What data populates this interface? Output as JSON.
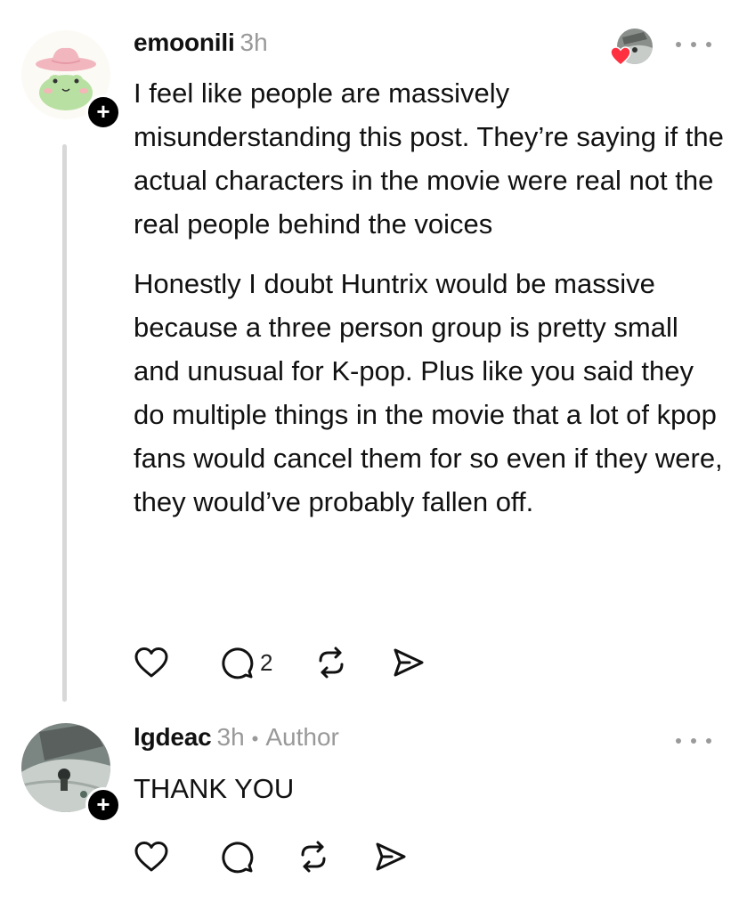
{
  "posts": [
    {
      "username": "emoonili",
      "time": "3h",
      "paragraphs": [
        "I feel like people are massively misunderstanding this post. They’re saying if the actual characters in the movie were real not the real people behind the voices",
        "Honestly I doubt Huntrix would be massive because a three person group is pretty small and unusual for K-pop. Plus like you said they do multiple things in the movie that a lot of kpop fans would cancel them for so even if they were, they would’ve probably fallen off."
      ],
      "reply_count": "2",
      "liked_by_author": true,
      "avatar_icon": "frog-cowboy-hat-avatar",
      "follow_icon": "plus-icon",
      "follow_symbol": "+"
    },
    {
      "username": "lgdeac",
      "time": "3h",
      "separator": "•",
      "author_label": "Author",
      "text": "THANK YOU",
      "reply_count": "",
      "avatar_icon": "photo-avatar",
      "follow_icon": "plus-icon",
      "follow_symbol": "+"
    }
  ],
  "colors": {
    "heart": "#ff3040",
    "muted": "#999999",
    "thread_line": "#d8d8d8",
    "text": "#111111"
  }
}
